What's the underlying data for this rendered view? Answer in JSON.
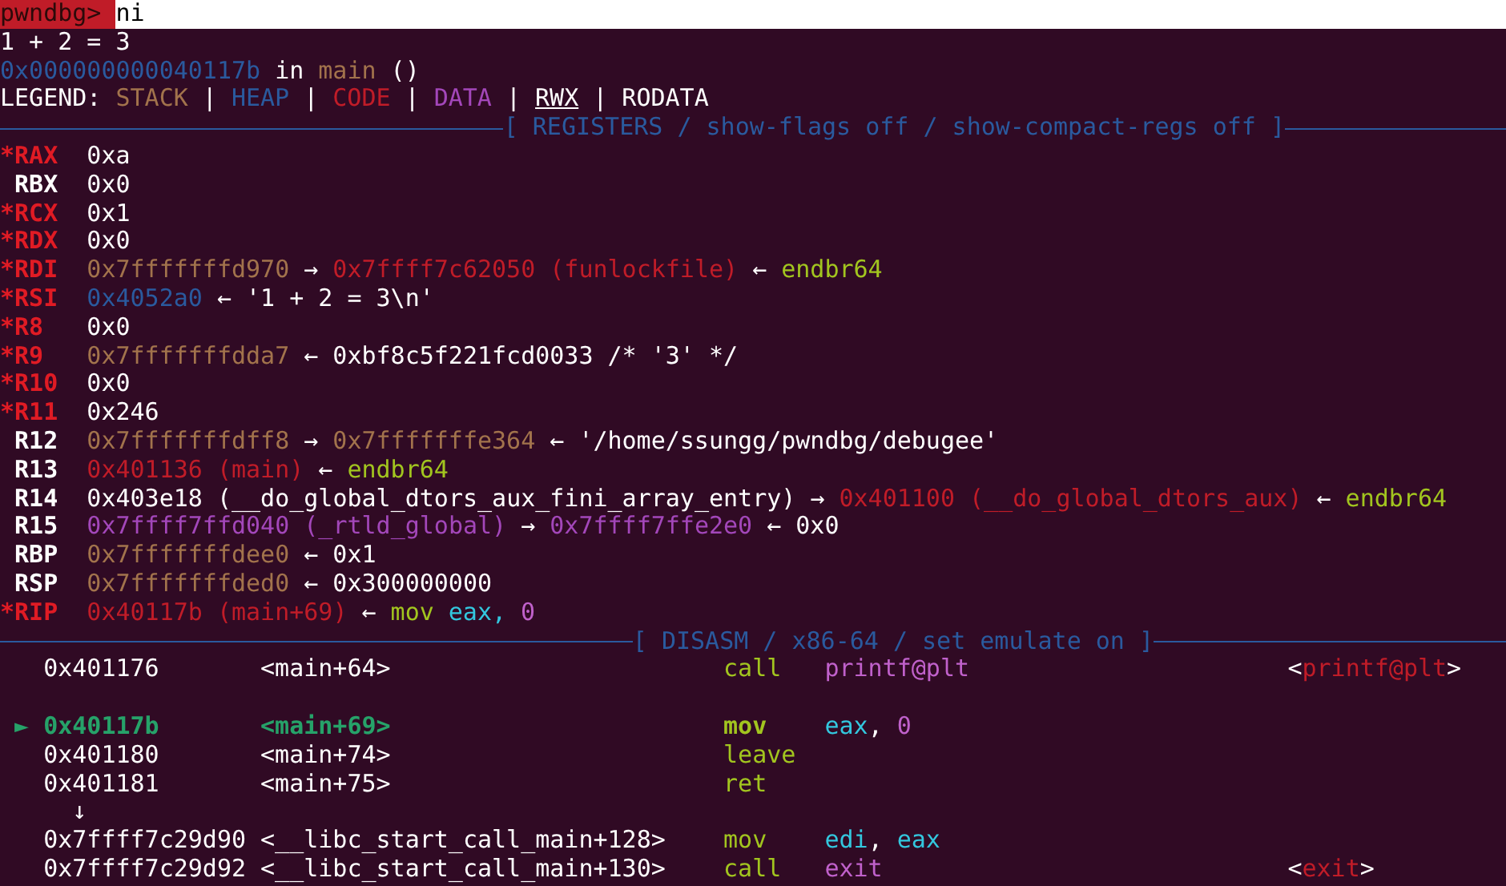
{
  "prompt": {
    "label": "pwndbg>",
    "command": "ni"
  },
  "output": [
    [
      {
        "text": "1 + 2 = 3",
        "color": "#ffffff"
      }
    ],
    [
      {
        "text": "0x000000000040117b",
        "color": "#2a5a9e"
      },
      {
        "text": "in",
        "color": "#ffffff"
      },
      {
        "text": "main",
        "color": "#a2734c"
      },
      {
        "text": "()",
        "color": "#ffffff"
      }
    ],
    [
      {
        "text": "LEGEND:",
        "color": "#ffffff"
      },
      {
        "text": "STACK",
        "color": "#a2734c"
      },
      {
        "text": "|",
        "color": "#ffffff"
      },
      {
        "text": "HEAP",
        "color": "#2a5a9e"
      },
      {
        "text": "|",
        "color": "#ffffff"
      },
      {
        "text": "CODE",
        "color": "#c01c28"
      },
      {
        "text": "|",
        "color": "#ffffff"
      },
      {
        "text": "DATA",
        "color": "#a347ba"
      },
      {
        "text": "|",
        "color": "#ffffff"
      },
      {
        "text": "RWX",
        "color": "#ffffff",
        "underline": true
      },
      {
        "text": "|",
        "color": "#ffffff"
      },
      {
        "text": "RODATA",
        "color": "#ffffff"
      }
    ]
  ],
  "registers_header": "[ REGISTERS / show-flags off / show-compact-regs off ]",
  "registers": [
    {
      "name": "*RAX",
      "changed": true,
      "value": [
        {
          "text": "0xa",
          "color": "#ffffff"
        }
      ]
    },
    {
      "name": "RBX",
      "changed": false,
      "value": [
        {
          "text": "0x0",
          "color": "#ffffff"
        }
      ]
    },
    {
      "name": "*RCX",
      "changed": true,
      "value": [
        {
          "text": "0x1",
          "color": "#ffffff"
        }
      ]
    },
    {
      "name": "*RDX",
      "changed": true,
      "value": [
        {
          "text": "0x0",
          "color": "#ffffff"
        }
      ]
    },
    {
      "name": "*RDI",
      "changed": true,
      "value": [
        {
          "text": "0x7fffffffd970",
          "color": "#a2734c"
        },
        {
          "text": "→",
          "color": "#ffffff"
        },
        {
          "text": "0x7ffff7c62050 (funlockfile)",
          "color": "#c01c28"
        },
        {
          "text": "←",
          "color": "#ffffff"
        },
        {
          "text": "endbr64",
          "color": "#a2c51f"
        }
      ]
    },
    {
      "name": "*RSI",
      "changed": true,
      "value": [
        {
          "text": "0x4052a0",
          "color": "#2a5a9e"
        },
        {
          "text": "←",
          "color": "#ffffff"
        },
        {
          "text": "'1 + 2 = 3\\n'",
          "color": "#ffffff"
        }
      ]
    },
    {
      "name": "*R8",
      "changed": true,
      "value": [
        {
          "text": "0x0",
          "color": "#ffffff"
        }
      ]
    },
    {
      "name": "*R9",
      "changed": true,
      "value": [
        {
          "text": "0x7fffffffdda7",
          "color": "#a2734c"
        },
        {
          "text": "←",
          "color": "#ffffff"
        },
        {
          "text": "0xbf8c5f221fcd0033 /* '3' */",
          "color": "#ffffff"
        }
      ]
    },
    {
      "name": "*R10",
      "changed": true,
      "value": [
        {
          "text": "0x0",
          "color": "#ffffff"
        }
      ]
    },
    {
      "name": "*R11",
      "changed": true,
      "value": [
        {
          "text": "0x246",
          "color": "#ffffff"
        }
      ]
    },
    {
      "name": "R12",
      "changed": false,
      "value": [
        {
          "text": "0x7fffffffdff8",
          "color": "#a2734c"
        },
        {
          "text": "→",
          "color": "#ffffff"
        },
        {
          "text": "0x7fffffffe364",
          "color": "#a2734c"
        },
        {
          "text": "←",
          "color": "#ffffff"
        },
        {
          "text": "'/home/ssungg/pwndbg/debugee'",
          "color": "#ffffff"
        }
      ]
    },
    {
      "name": "R13",
      "changed": false,
      "value": [
        {
          "text": "0x401136 (main)",
          "color": "#c01c28"
        },
        {
          "text": "←",
          "color": "#ffffff"
        },
        {
          "text": "endbr64",
          "color": "#a2c51f"
        }
      ]
    },
    {
      "name": "R14",
      "changed": false,
      "value": [
        {
          "text": "0x403e18 (__do_global_dtors_aux_fini_array_entry)",
          "color": "#ffffff"
        },
        {
          "text": "→",
          "color": "#ffffff"
        },
        {
          "text": "0x401100 (__do_global_dtors_aux)",
          "color": "#c01c28"
        },
        {
          "text": "←",
          "color": "#ffffff"
        },
        {
          "text": "endbr64",
          "color": "#a2c51f"
        }
      ]
    },
    {
      "name": "R15",
      "changed": false,
      "value": [
        {
          "text": "0x7ffff7ffd040 (_rtld_global)",
          "color": "#a347ba"
        },
        {
          "text": "→",
          "color": "#ffffff"
        },
        {
          "text": "0x7ffff7ffe2e0",
          "color": "#a347ba"
        },
        {
          "text": "←",
          "color": "#ffffff"
        },
        {
          "text": "0x0",
          "color": "#ffffff"
        }
      ]
    },
    {
      "name": "RBP",
      "changed": false,
      "value": [
        {
          "text": "0x7fffffffdee0",
          "color": "#a2734c"
        },
        {
          "text": "←",
          "color": "#ffffff"
        },
        {
          "text": "0x1",
          "color": "#ffffff"
        }
      ]
    },
    {
      "name": "RSP",
      "changed": false,
      "value": [
        {
          "text": "0x7fffffffded0",
          "color": "#a2734c"
        },
        {
          "text": "←",
          "color": "#ffffff"
        },
        {
          "text": "0x300000000",
          "color": "#ffffff"
        }
      ]
    },
    {
      "name": "*RIP",
      "changed": true,
      "value": [
        {
          "text": "0x40117b (main+69)",
          "color": "#c01c28"
        },
        {
          "text": "←",
          "color": "#ffffff"
        },
        {
          "text": "mov",
          "color": "#a2c51f"
        },
        {
          "text": "eax,",
          "color": "#33c7de"
        },
        {
          "text": "0",
          "color": "#c061cb"
        }
      ]
    }
  ],
  "disasm_header": "[ DISASM / x86-64 / set emulate on ]",
  "disasm": [
    {
      "kind": "instr",
      "current": false,
      "address": "0x401176",
      "symbol": "<main+64>",
      "mnemonic": "call",
      "operands": [
        {
          "text": "printf@plt",
          "color": "#c061cb"
        }
      ],
      "annotation": [
        {
          "text": "<",
          "color": "#ffffff"
        },
        {
          "text": "printf@plt",
          "color": "#c01c28"
        },
        {
          "text": ">",
          "color": "#ffffff"
        }
      ]
    },
    {
      "kind": "blank"
    },
    {
      "kind": "instr",
      "current": true,
      "marker": "►",
      "address": "0x40117b",
      "symbol": "<main+69>",
      "mnemonic": "mov",
      "operands": [
        {
          "text": "eax",
          "color": "#33c7de"
        },
        {
          "text": ",",
          "color": "#ffffff"
        },
        {
          "text": "0",
          "color": "#c061cb",
          "space": true
        }
      ]
    },
    {
      "kind": "instr",
      "current": false,
      "address": "0x401180",
      "symbol": "<main+74>",
      "mnemonic": "leave"
    },
    {
      "kind": "instr",
      "current": false,
      "address": "0x401181",
      "symbol": "<main+75>",
      "mnemonic": "ret"
    },
    {
      "kind": "arrow",
      "text": "↓"
    },
    {
      "kind": "instr",
      "current": false,
      "address": "0x7ffff7c29d90",
      "symbol": "<__libc_start_call_main+128>",
      "mnemonic": "mov",
      "operands": [
        {
          "text": "edi",
          "color": "#33c7de"
        },
        {
          "text": ",",
          "color": "#ffffff"
        },
        {
          "text": "eax",
          "color": "#33c7de",
          "space": true
        }
      ]
    },
    {
      "kind": "instr",
      "current": false,
      "address": "0x7ffff7c29d92",
      "symbol": "<__libc_start_call_main+130>",
      "mnemonic": "call",
      "operands": [
        {
          "text": "exit",
          "color": "#c061cb"
        }
      ],
      "annotation": [
        {
          "text": "<",
          "color": "#ffffff"
        },
        {
          "text": "exit",
          "color": "#c01c28"
        },
        {
          "text": ">",
          "color": "#ffffff"
        }
      ]
    }
  ]
}
